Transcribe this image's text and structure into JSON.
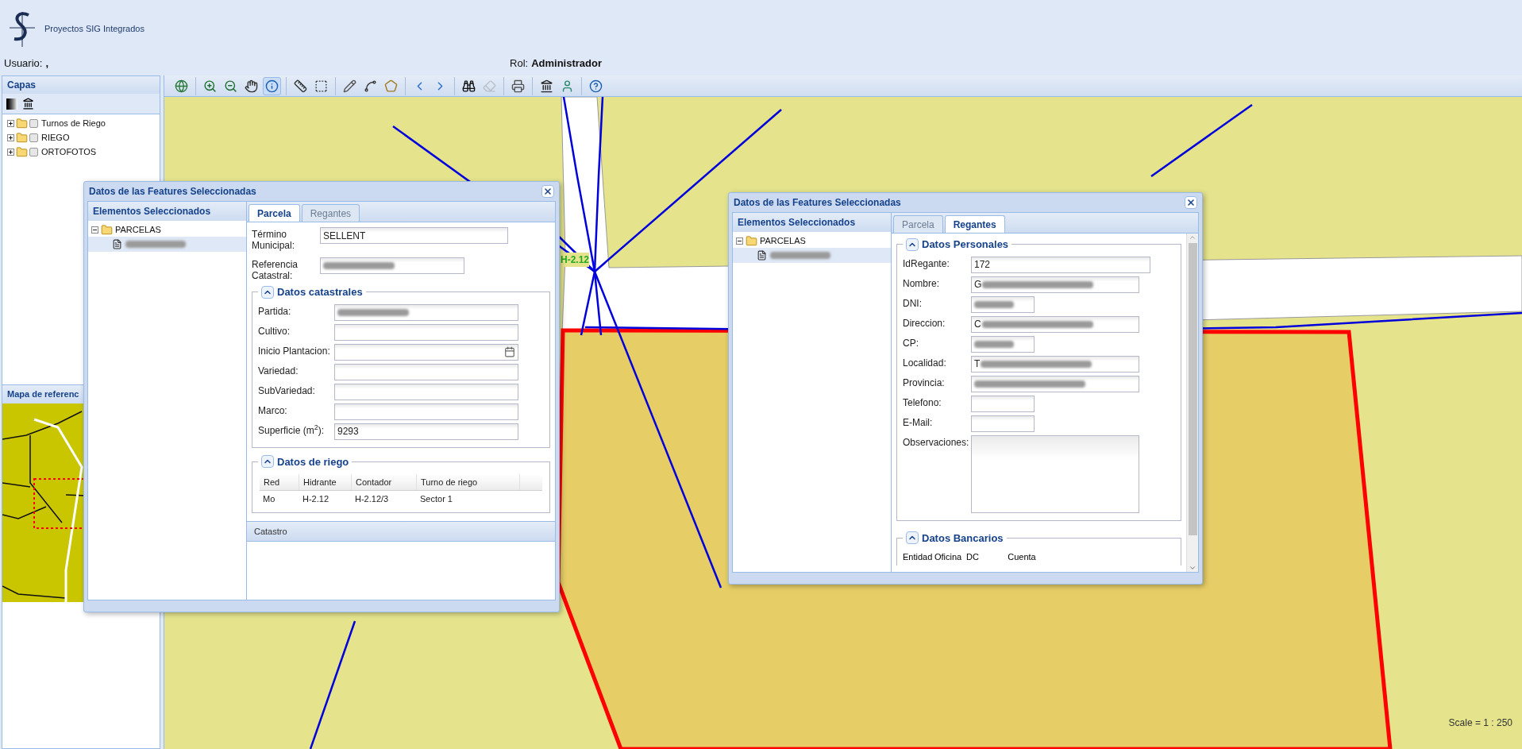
{
  "header": {
    "app_name": "Proyectos SIG Integrados",
    "user_label": "Usuario:",
    "user_value": ",",
    "role_label": "Rol:",
    "role_value": "Administrador"
  },
  "layers_panel": {
    "title": "Capas",
    "tree": [
      {
        "label": "Turnos de Riego",
        "checked": false,
        "expanded": false
      },
      {
        "label": "RIEGO",
        "checked": false,
        "expanded": false
      },
      {
        "label": "ORTOFOTOS",
        "checked": false,
        "expanded": false
      }
    ]
  },
  "reference_map": {
    "title": "Mapa de referenc"
  },
  "toolbar": {
    "groups": [
      [
        {
          "kind": "full-extent",
          "selected": false,
          "disabled": false
        }
      ],
      [
        {
          "kind": "zoom-in",
          "selected": false,
          "disabled": false
        },
        {
          "kind": "zoom-out",
          "selected": false,
          "disabled": false
        },
        {
          "kind": "pan",
          "selected": false,
          "disabled": false
        },
        {
          "kind": "info",
          "selected": true,
          "disabled": false
        }
      ],
      [
        {
          "kind": "measure-line",
          "selected": false,
          "disabled": false
        },
        {
          "kind": "measure-area",
          "selected": false,
          "disabled": false
        }
      ],
      [
        {
          "kind": "draw",
          "selected": false,
          "disabled": false
        },
        {
          "kind": "draw-line",
          "selected": false,
          "disabled": false
        },
        {
          "kind": "draw-polygon",
          "selected": false,
          "disabled": false
        }
      ],
      [
        {
          "kind": "back",
          "selected": false,
          "disabled": false
        },
        {
          "kind": "forward",
          "selected": false,
          "disabled": false
        }
      ],
      [
        {
          "kind": "find",
          "selected": false,
          "disabled": false
        },
        {
          "kind": "clear",
          "selected": false,
          "disabled": true
        }
      ],
      [
        {
          "kind": "print",
          "selected": false,
          "disabled": false
        }
      ],
      [
        {
          "kind": "admin",
          "selected": false,
          "disabled": false
        },
        {
          "kind": "user",
          "selected": false,
          "disabled": false
        }
      ],
      [
        {
          "kind": "help",
          "selected": false,
          "disabled": false
        }
      ]
    ]
  },
  "map": {
    "label": "H-2.12",
    "scale": "Scale = 1 : 250"
  },
  "dialogs": [
    {
      "title": "Datos de las Features Seleccionadas",
      "tree_title": "Elementos Seleccionados",
      "tree": {
        "label": "PARCELAS",
        "expanded": true,
        "children": [
          {
            "blurred": true,
            "selected": true
          }
        ]
      },
      "tabs": [
        {
          "label": "Parcela",
          "selected": true
        },
        {
          "label": "Regantes",
          "selected": false
        }
      ],
      "top_fields": [
        {
          "label": "Término Municipal:",
          "value": "SELLENT",
          "blurred": false,
          "kind": "wide"
        },
        {
          "label": "Referencia Catastral:",
          "blurred": true,
          "kind": "medium"
        }
      ],
      "sections": [
        {
          "kind": "fields",
          "title": "Datos catastrales",
          "expanded": true,
          "fields": [
            {
              "label": "Partida:",
              "blurred": true,
              "kind": "text"
            },
            {
              "label": "Cultivo:",
              "blurred": false,
              "kind": "text"
            },
            {
              "label": "Inicio Plantacion:",
              "blurred": false,
              "kind": "date"
            },
            {
              "label": "Variedad:",
              "blurred": false,
              "kind": "text"
            },
            {
              "label": "SubVariedad:",
              "blurred": false,
              "kind": "text"
            },
            {
              "label": "Marco:",
              "blurred": false,
              "kind": "text"
            },
            {
              "label": "Superficie (m$^{2}$):",
              "value": "9293",
              "blurred": false,
              "kind": "text"
            }
          ]
        },
        {
          "kind": "table",
          "title": "Datos de riego",
          "expanded": true,
          "columns": [
            "Red",
            "Hidrante",
            "Contador",
            "Turno de riego"
          ],
          "rows": [
            [
              "Mo",
              "H-2.12",
              "H-2.12/3",
              "Sector 1"
            ]
          ]
        }
      ],
      "collapsed_panels": [
        "Catastro"
      ],
      "scrollbar": false
    },
    {
      "title": "Datos de las Features Seleccionadas",
      "tree_title": "Elementos Seleccionados",
      "tree": {
        "label": "PARCELAS",
        "expanded": true,
        "children": [
          {
            "blurred": true,
            "selected": true
          }
        ]
      },
      "tabs": [
        {
          "label": "Parcela",
          "selected": false
        },
        {
          "label": "Regantes",
          "selected": true
        }
      ],
      "sections": [
        {
          "kind": "fields",
          "title": "Datos Personales",
          "expanded": true,
          "fields": [
            {
              "label": "IdRegante:",
              "value": "172",
              "blurred": false,
              "kind": "id"
            },
            {
              "label": "Nombre:",
              "value": "G",
              "blurred": true,
              "kind": "long"
            },
            {
              "label": "DNI:",
              "blurred": true,
              "kind": "short"
            },
            {
              "label": "Direccion:",
              "value": "C",
              "blurred": true,
              "kind": "long"
            },
            {
              "label": "CP:",
              "blurred": true,
              "kind": "short"
            },
            {
              "label": "Localidad:",
              "value": "T",
              "blurred": true,
              "kind": "long"
            },
            {
              "label": "Provincia:",
              "blurred": true,
              "kind": "long"
            },
            {
              "label": "Telefono:",
              "blurred": false,
              "kind": "short"
            },
            {
              "label": "E-Mail:",
              "blurred": false,
              "kind": "short"
            },
            {
              "label": "Observaciones:",
              "blurred": false,
              "kind": "textarea"
            }
          ]
        },
        {
          "kind": "columns",
          "title": "Datos Bancarios",
          "expanded": true,
          "columns": [
            "Entidad",
            "Oficina",
            "DC",
            "Cuenta"
          ]
        }
      ],
      "scrollbar": true
    }
  ]
}
